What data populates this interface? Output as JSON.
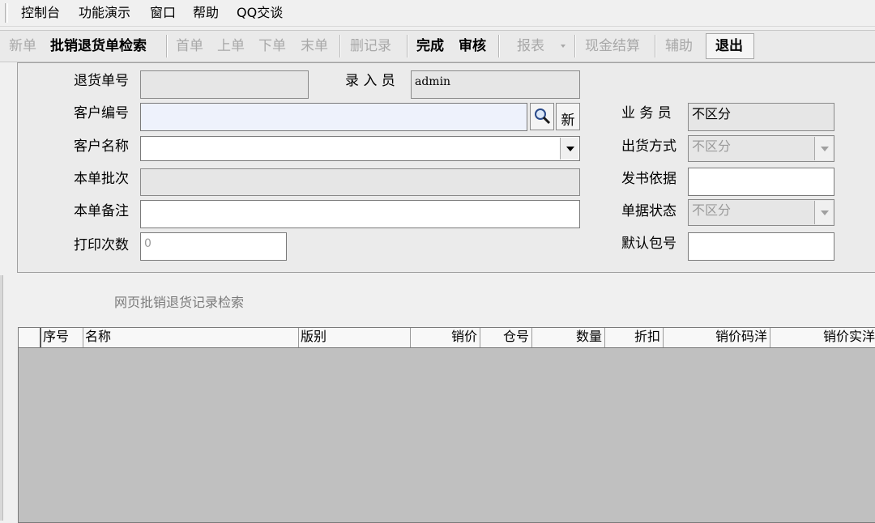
{
  "menubar": {
    "items": [
      "控制台",
      "功能演示",
      "窗口",
      "帮助",
      "QQ交谈"
    ]
  },
  "toolbar": {
    "new": "新单",
    "search": "批销退货单检索",
    "first": "首单",
    "prev": "上单",
    "next": "下单",
    "last": "末单",
    "delete": "删记录",
    "complete": "完成",
    "audit": "审核",
    "report": "报表",
    "cash": "现金结算",
    "assist": "辅助",
    "exit": "退出"
  },
  "form": {
    "return_no": {
      "label": "退货单号",
      "value": ""
    },
    "entered_by": {
      "label": "录 入 员",
      "value": "admin"
    },
    "customer_code": {
      "label": "客户编号",
      "value": "",
      "new_button": "新"
    },
    "salesman": {
      "label": "业 务 员",
      "value": "不区分"
    },
    "customer_name": {
      "label": "客户名称",
      "value": ""
    },
    "ship_method": {
      "label": "出货方式",
      "value": "不区分"
    },
    "batch": {
      "label": "本单批次",
      "value": ""
    },
    "issue_basis": {
      "label": "发书依据",
      "value": ""
    },
    "remark": {
      "label": "本单备注",
      "value": ""
    },
    "doc_status": {
      "label": "单据状态",
      "value": "不区分"
    },
    "print_count": {
      "label": "打印次数",
      "value": "0"
    },
    "default_package": {
      "label": "默认包号",
      "value": ""
    }
  },
  "section_title": "网页批销退货记录检索",
  "grid": {
    "columns": [
      "序号",
      "名称",
      "版别",
      "销价",
      "仓号",
      "数量",
      "折扣",
      "销价码洋",
      "销价实洋"
    ],
    "rows": []
  },
  "colors": {
    "background": "#f0f0f0",
    "grid_body": "#c0c0c0",
    "disabled_text": "#a8a8a8",
    "focus_field": "#eef2fc"
  }
}
